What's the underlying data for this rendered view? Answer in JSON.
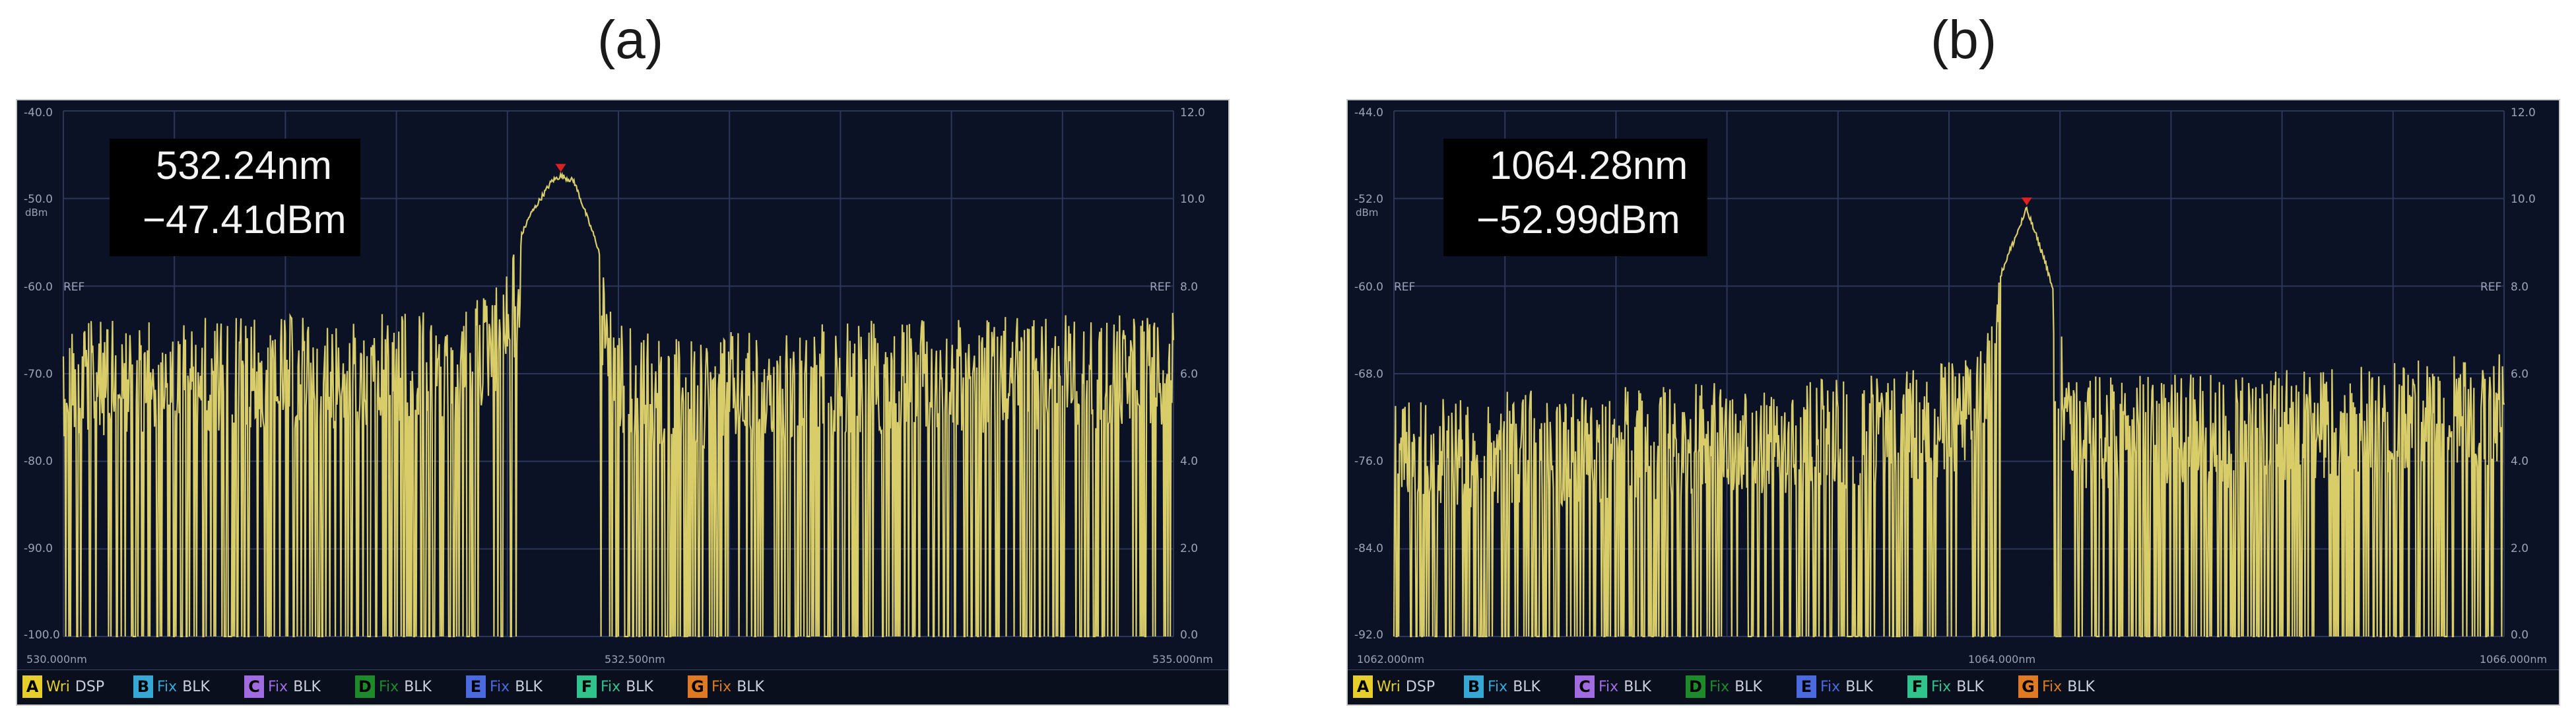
{
  "panels": [
    {
      "label": "(a)",
      "readout": {
        "wavelength": "532.24nm",
        "power": "−47.41dBm"
      },
      "left_ticks": [
        "-40.0",
        "-50.0",
        "-60.0",
        "-70.0",
        "-80.0",
        "-90.0",
        "-100.0"
      ],
      "left_unit": "dBm",
      "right_ticks": [
        "12.0",
        "10.0",
        "8.0",
        "6.0",
        "4.0",
        "2.0",
        "0.0"
      ],
      "ref_label": "REF",
      "x_ticks": [
        "530.000nm",
        "532.500nm",
        "535.000nm"
      ]
    },
    {
      "label": "(b)",
      "readout": {
        "wavelength": "1064.28nm",
        "power": "−52.99dBm"
      },
      "left_ticks": [
        "-44.0",
        "-52.0",
        "-60.0",
        "-68.0",
        "-76.0",
        "-84.0",
        "-92.0"
      ],
      "left_unit": "dBm",
      "right_ticks": [
        "12.0",
        "10.0",
        "8.0",
        "6.0",
        "4.0",
        "2.0",
        "0.0"
      ],
      "ref_label": "REF",
      "x_ticks": [
        "1062.000nm",
        "1064.000nm",
        "1066.000nm"
      ]
    }
  ],
  "trace_bar": [
    {
      "letter": "A",
      "mode": "Wri",
      "state": "DSP",
      "color": "#e6cf2a"
    },
    {
      "letter": "B",
      "mode": "Fix",
      "state": "BLK",
      "color": "#36a8d6"
    },
    {
      "letter": "C",
      "mode": "Fix",
      "state": "BLK",
      "color": "#a06ce0"
    },
    {
      "letter": "D",
      "mode": "Fix",
      "state": "BLK",
      "color": "#1f8a2c"
    },
    {
      "letter": "E",
      "mode": "Fix",
      "state": "BLK",
      "color": "#4c6ae0"
    },
    {
      "letter": "F",
      "mode": "Fix",
      "state": "BLK",
      "color": "#2ec48c"
    },
    {
      "letter": "G",
      "mode": "Fix",
      "state": "BLK",
      "color": "#e07a22"
    }
  ],
  "colors": {
    "trace": "#d9cd6a",
    "marker": "#e02020",
    "screen": "#0b1226",
    "grid": "#2c3658"
  },
  "chart_data": [
    {
      "type": "line",
      "xlabel": "",
      "ylabel": "dBm",
      "xlim": [
        530.0,
        535.0
      ],
      "ylim": [
        -100.0,
        -40.0
      ],
      "grid": true,
      "peak": {
        "x": 532.24,
        "y": -47.41
      },
      "series": [
        {
          "values_description_x": [
            530.0,
            531.5,
            531.8,
            532.0,
            532.1,
            532.2,
            532.24,
            532.3,
            532.4,
            532.5,
            532.7,
            533.5,
            535.0
          ],
          "y": [
            -64,
            -63,
            -63,
            -58,
            -52,
            -48,
            -47.41,
            -48,
            -55,
            -64,
            -66,
            -64,
            -63
          ]
        }
      ]
    },
    {
      "type": "line",
      "xlabel": "",
      "ylabel": "dBm",
      "xlim": [
        1062.0,
        1066.0
      ],
      "ylim": [
        -92.0,
        -44.0
      ],
      "grid": true,
      "peak": {
        "x": 1064.28,
        "y": -52.99
      },
      "series": [
        {
          "values_description_x": [
            1062.0,
            1063.0,
            1063.8,
            1064.1,
            1064.2,
            1064.28,
            1064.35,
            1064.45,
            1065.0,
            1066.0
          ],
          "y": [
            -70,
            -69,
            -68,
            -66,
            -58,
            -52.99,
            -58,
            -68,
            -68,
            -66
          ]
        }
      ]
    }
  ]
}
